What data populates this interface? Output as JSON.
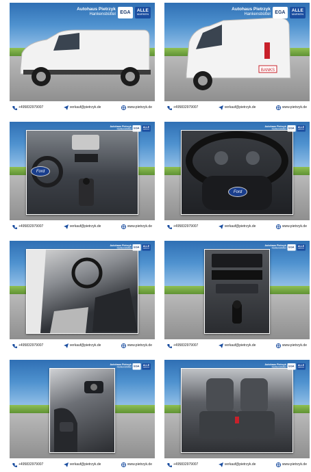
{
  "dealer": {
    "name": "Autohaus Pietrzyk",
    "location": "Hankensbüttel"
  },
  "badges": {
    "ega": "EGA",
    "alle": "ALLE",
    "alle_sub": "MARKEN"
  },
  "contact": {
    "phone": "+495832979007",
    "email": "verkauf@pietrzyk.de",
    "web": "www.pietrzyk.de"
  },
  "vehicle": {
    "brand_badge": "Ford",
    "rear_sticker": "BANKS"
  },
  "colors": {
    "sky": "#3f7ec0",
    "alle_blue": "#1b4ea0",
    "contact_icon": "#1b4ea0"
  },
  "photos": [
    {
      "name": "exterior-side",
      "icon": "van-side"
    },
    {
      "name": "exterior-rear",
      "icon": "van-rear"
    },
    {
      "name": "dashboard",
      "icon": "dashboard"
    },
    {
      "name": "steering-wheel",
      "icon": "steering-wheel"
    },
    {
      "name": "driver-door-interior",
      "icon": "cabin"
    },
    {
      "name": "center-console",
      "icon": "console"
    },
    {
      "name": "door-controls",
      "icon": "door-panel"
    },
    {
      "name": "seats",
      "icon": "seats"
    }
  ]
}
